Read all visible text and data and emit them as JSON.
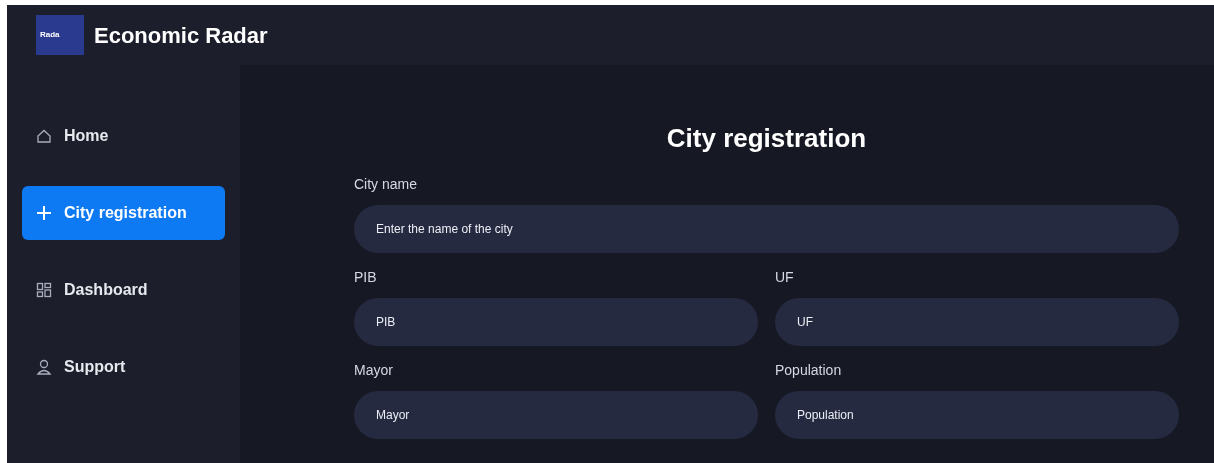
{
  "app": {
    "logo_text": "Rada",
    "title": "Economic Radar"
  },
  "sidebar": {
    "items": [
      {
        "label": "Home",
        "selected": false
      },
      {
        "label": "City registration",
        "selected": true
      },
      {
        "label": "Dashboard",
        "selected": false
      },
      {
        "label": "Support",
        "selected": false
      }
    ]
  },
  "form": {
    "title": "City registration",
    "rows": [
      [
        {
          "label": "City name",
          "placeholder": "Enter the name of the city"
        }
      ],
      [
        {
          "label": "PIB",
          "placeholder": "PIB"
        },
        {
          "label": "UF",
          "placeholder": "UF"
        }
      ],
      [
        {
          "label": "Mayor",
          "placeholder": "Mayor"
        },
        {
          "label": "Population",
          "placeholder": "Population"
        }
      ]
    ]
  }
}
